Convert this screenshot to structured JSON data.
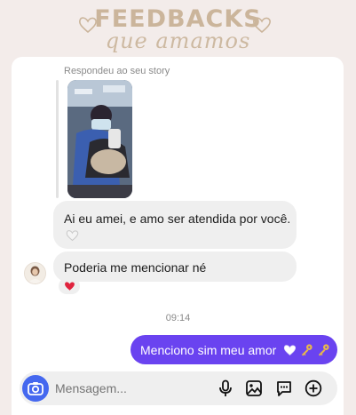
{
  "banner": {
    "title_line1": "FEEDBACKS",
    "title_line2": "que amamos",
    "accent_color": "#cbb59b"
  },
  "thread": {
    "story_reply_label": "Respondeu ao seu story",
    "messages_in": [
      {
        "text": "Ai eu amei, e amo ser atendida por você.",
        "reaction": "white-heart"
      },
      {
        "text": "Poderia me mencionar né",
        "reaction": "red-heart"
      }
    ],
    "timestamp": "09:14",
    "message_out": {
      "text": "Menciono sim meu amor",
      "emoji_icons": [
        "white-heart",
        "key",
        "key"
      ]
    }
  },
  "composer": {
    "placeholder": "Mensagem...",
    "icons": [
      "camera-icon",
      "microphone-icon",
      "image-icon",
      "sticker-icon",
      "add-icon"
    ]
  },
  "colors": {
    "sent_bubble": "#6a43f0",
    "received_bubble": "#efefef",
    "camera_button": "#4568ef",
    "page_background": "#f3ecea"
  }
}
